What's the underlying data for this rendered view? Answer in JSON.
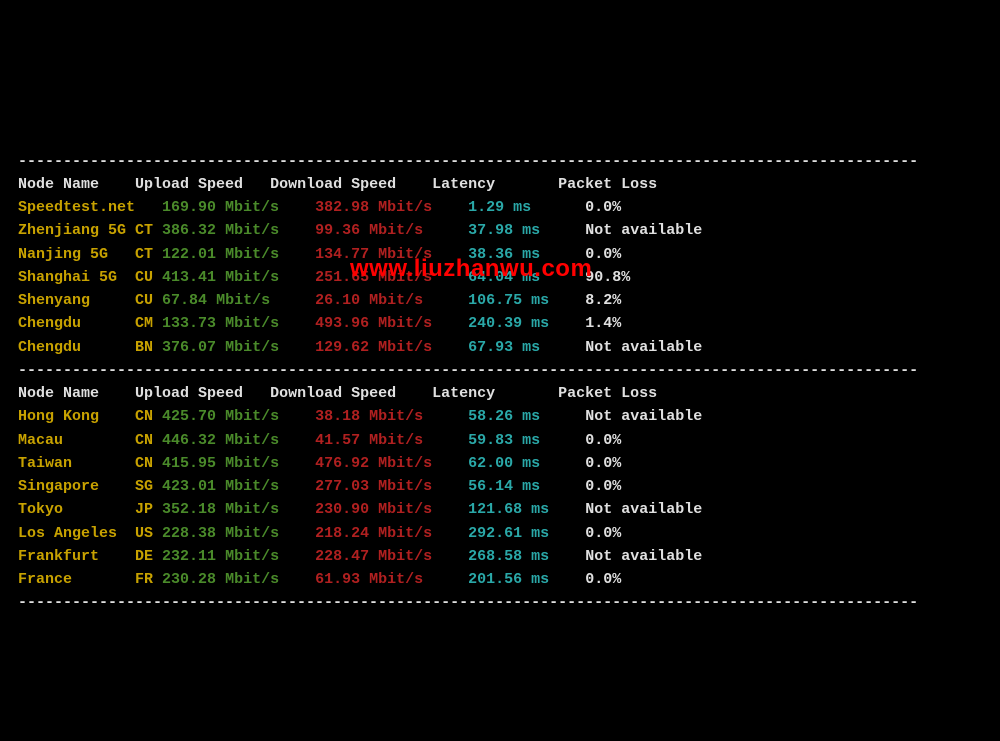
{
  "watermark": "www.liuzhanwu.com",
  "dashes": "----------------------------------------------------------------------------------------------------",
  "headers": {
    "node": "Node Name",
    "upload": "Upload Speed",
    "download": "Download Speed",
    "latency": "Latency",
    "loss": "Packet Loss"
  },
  "section1": [
    {
      "node": "Speedtest.net",
      "tag": "",
      "upload_v": "169.90",
      "upload_u": "Mbit/s",
      "download_v": "382.98",
      "download_u": "Mbit/s",
      "latency_v": "1.29",
      "latency_u": "ms",
      "loss": "0.0%"
    },
    {
      "node": "Zhenjiang 5G",
      "tag": "CT",
      "upload_v": "386.32",
      "upload_u": "Mbit/s",
      "download_v": "99.36",
      "download_u": "Mbit/s",
      "latency_v": "37.98",
      "latency_u": "ms",
      "loss": "Not available"
    },
    {
      "node": "Nanjing 5G",
      "tag": "CT",
      "upload_v": "122.01",
      "upload_u": "Mbit/s",
      "download_v": "134.77",
      "download_u": "Mbit/s",
      "latency_v": "38.36",
      "latency_u": "ms",
      "loss": "0.0%"
    },
    {
      "node": "Shanghai 5G",
      "tag": "CU",
      "upload_v": "413.41",
      "upload_u": "Mbit/s",
      "download_v": "251.65",
      "download_u": "Mbit/s",
      "latency_v": "64.04",
      "latency_u": "ms",
      "loss": "90.8%"
    },
    {
      "node": "Shenyang",
      "tag": "CU",
      "upload_v": "67.84",
      "upload_u": "Mbit/s",
      "download_v": "26.10",
      "download_u": "Mbit/s",
      "latency_v": "106.75",
      "latency_u": "ms",
      "loss": "8.2%"
    },
    {
      "node": "Chengdu",
      "tag": "CM",
      "upload_v": "133.73",
      "upload_u": "Mbit/s",
      "download_v": "493.96",
      "download_u": "Mbit/s",
      "latency_v": "240.39",
      "latency_u": "ms",
      "loss": "1.4%"
    },
    {
      "node": "Chengdu",
      "tag": "BN",
      "upload_v": "376.07",
      "upload_u": "Mbit/s",
      "download_v": "129.62",
      "download_u": "Mbit/s",
      "latency_v": "67.93",
      "latency_u": "ms",
      "loss": "Not available"
    }
  ],
  "section2": [
    {
      "node": "Hong Kong",
      "tag": "CN",
      "upload_v": "425.70",
      "upload_u": "Mbit/s",
      "download_v": "38.18",
      "download_u": "Mbit/s",
      "latency_v": "58.26",
      "latency_u": "ms",
      "loss": "Not available"
    },
    {
      "node": "Macau",
      "tag": "CN",
      "upload_v": "446.32",
      "upload_u": "Mbit/s",
      "download_v": "41.57",
      "download_u": "Mbit/s",
      "latency_v": "59.83",
      "latency_u": "ms",
      "loss": "0.0%"
    },
    {
      "node": "Taiwan",
      "tag": "CN",
      "upload_v": "415.95",
      "upload_u": "Mbit/s",
      "download_v": "476.92",
      "download_u": "Mbit/s",
      "latency_v": "62.00",
      "latency_u": "ms",
      "loss": "0.0%"
    },
    {
      "node": "Singapore",
      "tag": "SG",
      "upload_v": "423.01",
      "upload_u": "Mbit/s",
      "download_v": "277.03",
      "download_u": "Mbit/s",
      "latency_v": "56.14",
      "latency_u": "ms",
      "loss": "0.0%"
    },
    {
      "node": "Tokyo",
      "tag": "JP",
      "upload_v": "352.18",
      "upload_u": "Mbit/s",
      "download_v": "230.90",
      "download_u": "Mbit/s",
      "latency_v": "121.68",
      "latency_u": "ms",
      "loss": "Not available"
    },
    {
      "node": "Los Angeles",
      "tag": "US",
      "upload_v": "228.38",
      "upload_u": "Mbit/s",
      "download_v": "218.24",
      "download_u": "Mbit/s",
      "latency_v": "292.61",
      "latency_u": "ms",
      "loss": "0.0%"
    },
    {
      "node": "Frankfurt",
      "tag": "DE",
      "upload_v": "232.11",
      "upload_u": "Mbit/s",
      "download_v": "228.47",
      "download_u": "Mbit/s",
      "latency_v": "268.58",
      "latency_u": "ms",
      "loss": "Not available"
    },
    {
      "node": "France",
      "tag": "FR",
      "upload_v": "230.28",
      "upload_u": "Mbit/s",
      "download_v": "61.93",
      "download_u": "Mbit/s",
      "latency_v": "201.56",
      "latency_u": "ms",
      "loss": "0.0%"
    }
  ]
}
